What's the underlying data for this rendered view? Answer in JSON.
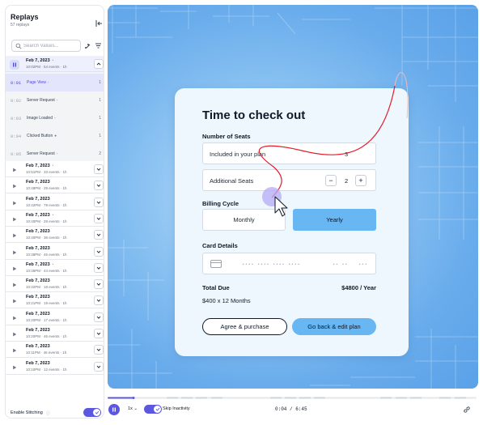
{
  "sidebar": {
    "title": "Replays",
    "subtitle": "57 replays",
    "search_placeholder": "Search Values...",
    "active_session": {
      "date": "Feb 7, 2023",
      "meta": "10:02PM · 54 events · 1h"
    },
    "events": [
      {
        "time": "0:01",
        "name": "Page View",
        "count": "1"
      },
      {
        "time": "0:02",
        "name": "Server Request",
        "count": "1"
      },
      {
        "time": "0:03",
        "name": "Image Loaded",
        "count": "1"
      },
      {
        "time": "0:04",
        "name": "Clicked Button",
        "count": "1"
      },
      {
        "time": "0:05",
        "name": "Server Request",
        "count": "2"
      }
    ],
    "sessions": [
      {
        "date": "Feb 7, 2023",
        "meta": "10:51PM · 33 events · 1h"
      },
      {
        "date": "Feb 7, 2023",
        "meta": "10:48PM · 29 events · 1h"
      },
      {
        "date": "Feb 7, 2023",
        "meta": "10:42PM · 79 events · 1h"
      },
      {
        "date": "Feb 7, 2023",
        "meta": "10:40PM · 28 events · 1h"
      },
      {
        "date": "Feb 7, 2023",
        "meta": "10:40PM · 36 events · 1h"
      },
      {
        "date": "Feb 7, 2023",
        "meta": "10:38PM · 46 events · 1h"
      },
      {
        "date": "Feb 7, 2023",
        "meta": "10:36PM · 44 events · 1h"
      },
      {
        "date": "Feb 7, 2023",
        "meta": "10:32PM · 18 events · 1h"
      },
      {
        "date": "Feb 7, 2023",
        "meta": "10:21PM · 19 events · 1h"
      },
      {
        "date": "Feb 7, 2023",
        "meta": "10:20PM · 17 events · 1h"
      },
      {
        "date": "Feb 7, 2023",
        "meta": "10:20PM · 46 events · 1h"
      },
      {
        "date": "Feb 7, 2023",
        "meta": "10:11PM · 46 events · 1h"
      },
      {
        "date": "Feb 7, 2023",
        "meta": "10:10PM · 12 events · 1h"
      }
    ],
    "stitching_label": "Enable Stitching",
    "stitching_info": "ⓘ"
  },
  "checkout": {
    "title": "Time to check out",
    "seats_label": "Number of Seats",
    "included_label": "Included in your plan",
    "included_value": "3",
    "additional_label": "Additional Seats",
    "minus": "−",
    "plus": "+",
    "additional_value": "2",
    "billing_label": "Billing Cycle",
    "monthly": "Monthly",
    "yearly": "Yearly",
    "card_label": "Card Details",
    "card_number_mask": "•••• •••• •••• ••••",
    "card_expiry_mask": "•• ••",
    "card_cvc_mask": "•••",
    "total_label": "Total Due",
    "total_value": "$4800 / Year",
    "total_sub": "$400 x 12 Months",
    "agree_button": "Agree & purchase",
    "back_button": "Go back & edit plan"
  },
  "player": {
    "speed": "1x ⌄",
    "skip_label": "Skip Inactivity",
    "time": "0:04 / 6:45",
    "progress": 0.07
  },
  "colors": {
    "accent": "#5b57e0",
    "stage_blue": "#69acec",
    "cta_blue": "#68b7f3",
    "trail_red": "#e11d2a"
  },
  "icons": [
    "collapse-icon",
    "search-icon",
    "add-filter-icon",
    "filter-icon",
    "pause-icon",
    "play-icon",
    "chevron-down-icon",
    "chevron-up-icon",
    "credit-card-icon",
    "cursor-icon",
    "link-icon",
    "check-icon"
  ]
}
